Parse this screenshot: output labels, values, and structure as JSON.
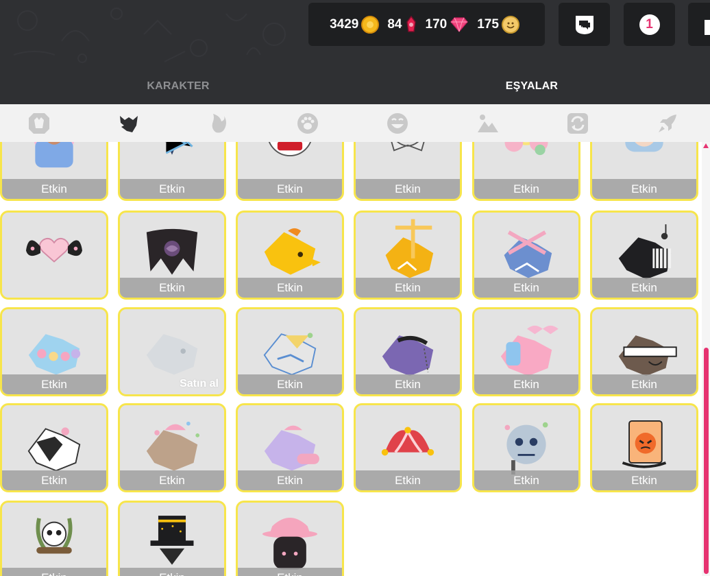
{
  "currency": {
    "coins": "3429",
    "magic": "84",
    "red": "170",
    "gems": "175"
  },
  "notifications": {
    "count": "1"
  },
  "tabs": {
    "karakter": "KARAKTER",
    "esyalar": "EŞYALAR",
    "active": "esyalar"
  },
  "categories": [
    {
      "icon": "dog-head-badge-icon"
    },
    {
      "icon": "wolf-head-icon",
      "active": true
    },
    {
      "icon": "tail-icon"
    },
    {
      "icon": "paw-icon"
    },
    {
      "icon": "smiley-face-icon"
    },
    {
      "icon": "landscape-picture-icon"
    },
    {
      "icon": "refresh-arrows-icon"
    },
    {
      "icon": "rocket-icon"
    }
  ],
  "items": [
    {
      "name": "pink-bunny-hat-bearded-avatar",
      "status": "Etkin"
    },
    {
      "name": "ice-crystal-crown",
      "status": "Etkin"
    },
    {
      "name": "clown-face-mask",
      "status": "Etkin"
    },
    {
      "name": "black-bow-collar",
      "status": "Etkin"
    },
    {
      "name": "flower-face-hat",
      "status": "Etkin"
    },
    {
      "name": "granny-bow-hat",
      "status": "Etkin"
    },
    {
      "name": "winged-heart",
      "status": ""
    },
    {
      "name": "dark-rose-wings",
      "status": "Etkin"
    },
    {
      "name": "golden-wolf-bow",
      "status": "Etkin"
    },
    {
      "name": "golden-wolf-puppet",
      "status": "Etkin"
    },
    {
      "name": "pink-marionette-wolf",
      "status": "Etkin"
    },
    {
      "name": "piano-wolf",
      "status": "Etkin"
    },
    {
      "name": "pastel-flower-wolf",
      "status": "Etkin"
    },
    {
      "name": "ghost-wolf",
      "status": "",
      "buy": "Satın al"
    },
    {
      "name": "fox-mask-wolf",
      "status": "Etkin"
    },
    {
      "name": "purple-rope-wolf",
      "status": "Etkin"
    },
    {
      "name": "pink-bow-wolf",
      "status": "Etkin"
    },
    {
      "name": "blindfold-wolf",
      "status": "Etkin"
    },
    {
      "name": "black-kitsune-mask",
      "status": "Etkin"
    },
    {
      "name": "pastel-party-wolf",
      "status": "Etkin"
    },
    {
      "name": "love-pastel-wolf",
      "status": "Etkin"
    },
    {
      "name": "jester-hat",
      "status": "Etkin"
    },
    {
      "name": "skeleton-music-mask",
      "status": "Etkin"
    },
    {
      "name": "angry-fire-card",
      "status": "Etkin"
    },
    {
      "name": "laurel-skull",
      "status": "Etkin"
    },
    {
      "name": "starry-top-hat",
      "status": "Etkin"
    },
    {
      "name": "pink-detective-hat",
      "status": "Etkin"
    }
  ]
}
